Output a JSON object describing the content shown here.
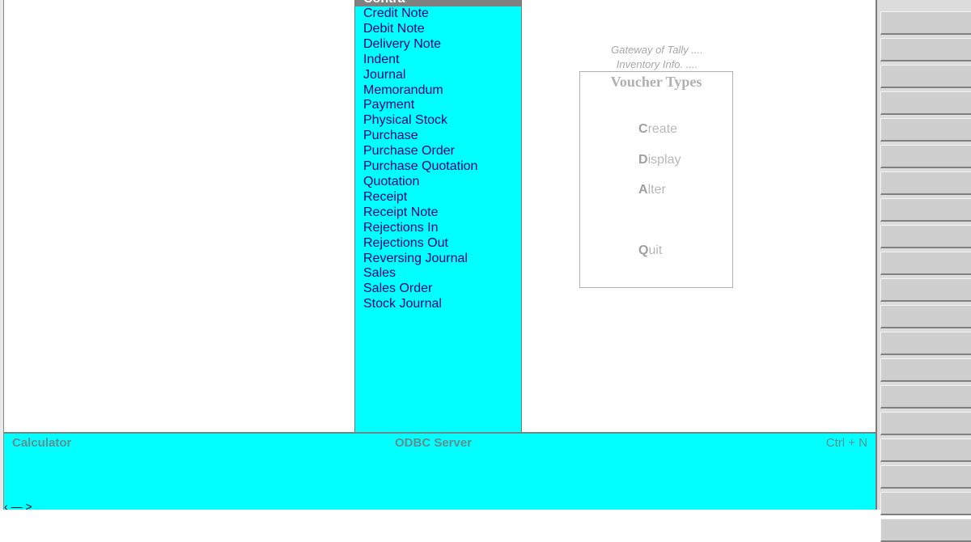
{
  "voucher_list": {
    "selected": "Contra",
    "items": [
      "Credit Note",
      "Debit Note",
      "Delivery Note",
      "Indent",
      "Journal",
      "Memorandum",
      "Payment",
      "Physical Stock",
      "Purchase",
      "Purchase Order",
      "Purchase Quotation",
      "Quotation",
      "Receipt",
      "Receipt Note",
      "Rejections In",
      "Rejections Out",
      "Reversing Journal",
      "Sales",
      "Sales Order",
      "Stock Journal"
    ]
  },
  "breadcrumb": {
    "line1": "Gateway of Tally ....",
    "line2": "Inventory Info. ...."
  },
  "menu": {
    "title": "Voucher Types",
    "create_key": "C",
    "create_rest": "reate",
    "display_key": "D",
    "display_rest": "isplay",
    "alter_key": "A",
    "alter_rest": "lter",
    "quit_key": "Q",
    "quit_rest": "uit"
  },
  "bottom_panel": {
    "calculator": "Calculator",
    "odbc": "ODBC Server",
    "shortcut": "Ctrl + N",
    "prompt": "‹ — >"
  },
  "right_buttons": [
    "",
    "",
    "",
    "",
    "",
    "",
    "",
    "",
    "",
    "",
    "",
    "",
    "",
    "",
    "",
    "",
    "",
    "",
    "",
    ""
  ],
  "colors": {
    "list_bg": "#00ffff",
    "selected_bg": "#808080",
    "item_text": "#000080",
    "menu_text": "#b8b8b8"
  }
}
